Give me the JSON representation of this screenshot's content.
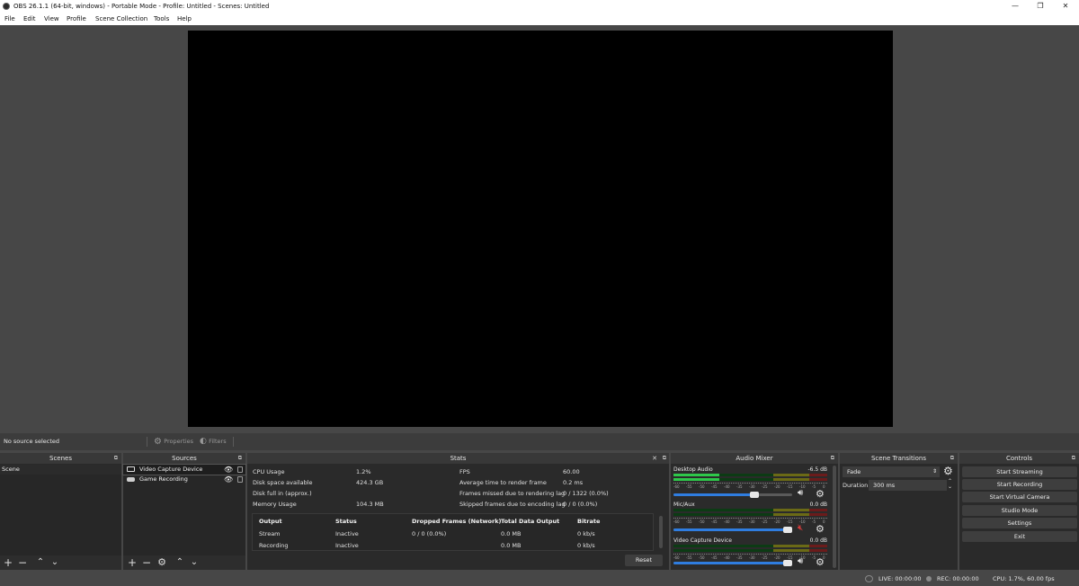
{
  "window": {
    "title": "OBS 26.1.1 (64-bit, windows) - Portable Mode - Profile: Untitled - Scenes: Untitled",
    "minimize": "—",
    "maximize": "❐",
    "close": "✕"
  },
  "menu": [
    "File",
    "Edit",
    "View",
    "Profile",
    "Scene Collection",
    "Tools",
    "Help"
  ],
  "context": {
    "no_source": "No source selected",
    "properties": "Properties",
    "filters": "Filters"
  },
  "scenes": {
    "title": "Scenes",
    "items": [
      "Scene"
    ]
  },
  "sources": {
    "title": "Sources",
    "items": [
      "Video Capture Device",
      "Game Recording"
    ]
  },
  "stats": {
    "title": "Stats",
    "left": [
      {
        "label": "CPU Usage",
        "value": "1.2%"
      },
      {
        "label": "Disk space available",
        "value": "424.3 GB"
      },
      {
        "label": "Disk full in (approx.)",
        "value": ""
      },
      {
        "label": "Memory Usage",
        "value": "104.3 MB"
      }
    ],
    "right": [
      {
        "label": "FPS",
        "value": "60.00"
      },
      {
        "label": "Average time to render frame",
        "value": "0.2 ms"
      },
      {
        "label": "Frames missed due to rendering lag",
        "value": "0 / 1322 (0.0%)"
      },
      {
        "label": "Skipped frames due to encoding lag",
        "value": "0 / 0 (0.0%)"
      }
    ],
    "output_headers": [
      "Output",
      "Status",
      "Dropped Frames (Network)",
      "Total Data Output",
      "Bitrate"
    ],
    "outputs": [
      [
        "Stream",
        "Inactive",
        "0 / 0 (0.0%)",
        "0.0 MB",
        "0 kb/s"
      ],
      [
        "Recording",
        "Inactive",
        "",
        "0.0 MB",
        "0 kb/s"
      ]
    ],
    "reset": "Reset"
  },
  "audio_mixer": {
    "title": "Audio Mixer",
    "tick_labels": [
      "-60",
      "-55",
      "-50",
      "-45",
      "-40",
      "-35",
      "-30",
      "-25",
      "-20",
      "-15",
      "-10",
      "-5",
      "0"
    ],
    "channels": [
      {
        "name": "Desktop Audio",
        "db": "-6.5 dB",
        "level": 0.3,
        "volume": 0.72,
        "muted": false
      },
      {
        "name": "Mic/Aux",
        "db": "0.0 dB",
        "level": 0.0,
        "volume": 1.0,
        "muted": true
      },
      {
        "name": "Video Capture Device",
        "db": "0.0 dB",
        "level": 0.0,
        "volume": 1.0,
        "muted": false
      }
    ]
  },
  "transitions": {
    "title": "Scene Transitions",
    "selected": "Fade",
    "duration_label": "Duration",
    "duration_value": "300 ms"
  },
  "controls": {
    "title": "Controls",
    "buttons": [
      "Start Streaming",
      "Start Recording",
      "Start Virtual Camera",
      "Studio Mode",
      "Settings",
      "Exit"
    ]
  },
  "status": {
    "live": "LIVE: 00:00:00",
    "rec": "REC: 00:00:00",
    "cpu": "CPU: 1.7%, 60.00 fps"
  }
}
